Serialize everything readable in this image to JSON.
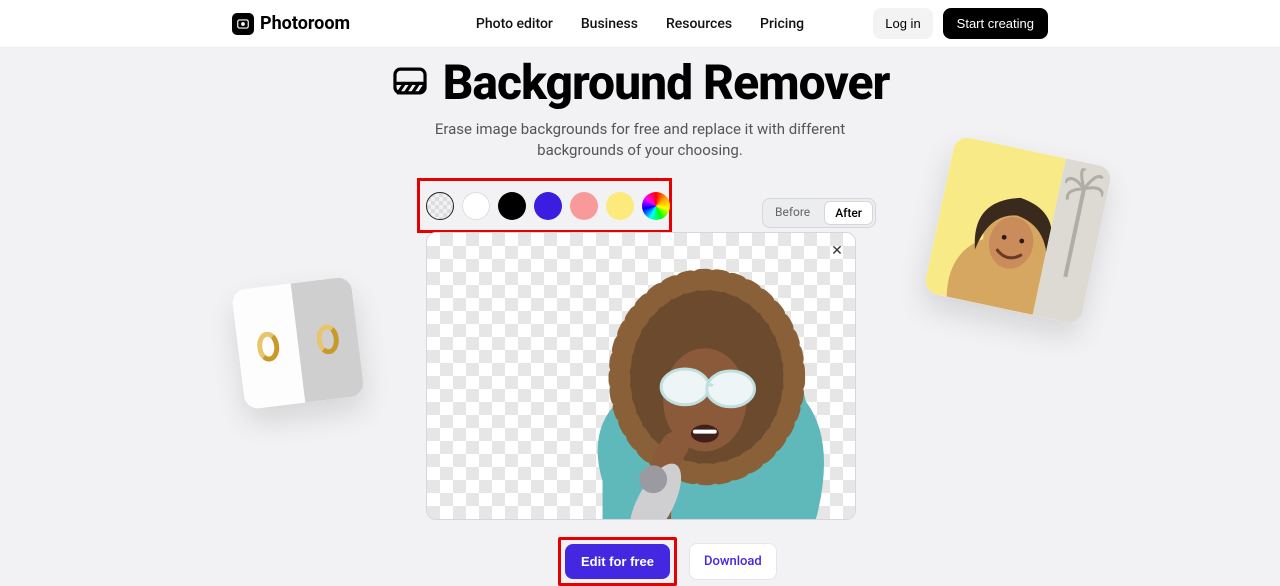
{
  "header": {
    "brand": "Photoroom",
    "nav": [
      "Photo editor",
      "Business",
      "Resources",
      "Pricing"
    ],
    "login": "Log in",
    "start": "Start creating"
  },
  "hero": {
    "title": "Background Remover",
    "subtitle": "Erase image backgrounds for free and replace it with different backgrounds of your choosing."
  },
  "swatches": [
    "transparent",
    "white",
    "black",
    "blue",
    "pink",
    "yellow",
    "rainbow"
  ],
  "toggle": {
    "before": "Before",
    "after": "After"
  },
  "actions": {
    "edit": "Edit for free",
    "download": "Download"
  }
}
